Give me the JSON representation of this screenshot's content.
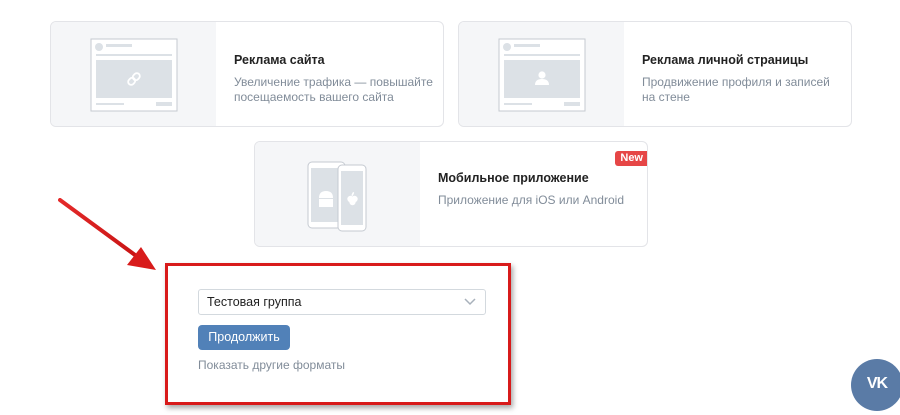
{
  "cards": {
    "site": {
      "title": "Реклама сайта",
      "description": "Увеличение трафика — повышайте посещаемость вашего сайта",
      "icon": "link-icon"
    },
    "profile": {
      "title": "Реклама личной страницы",
      "description": "Продвижение профиля и записей на стене",
      "icon": "user-icon"
    },
    "mobile": {
      "title": "Мобильное приложение",
      "description": "Приложение для iOS или Android",
      "badge": "New",
      "icons": [
        "android-icon",
        "apple-icon"
      ]
    }
  },
  "form": {
    "select_value": "Тестовая группа",
    "continue_label": "Продолжить",
    "more_formats_label": "Показать другие форматы"
  },
  "floating": {
    "vk_label": "VK"
  },
  "colors": {
    "accent": "#5181b8",
    "badge": "#e64646",
    "highlight": "#d81b1b",
    "muted_text": "#818c99",
    "vk_button": "#5a7ba6"
  }
}
